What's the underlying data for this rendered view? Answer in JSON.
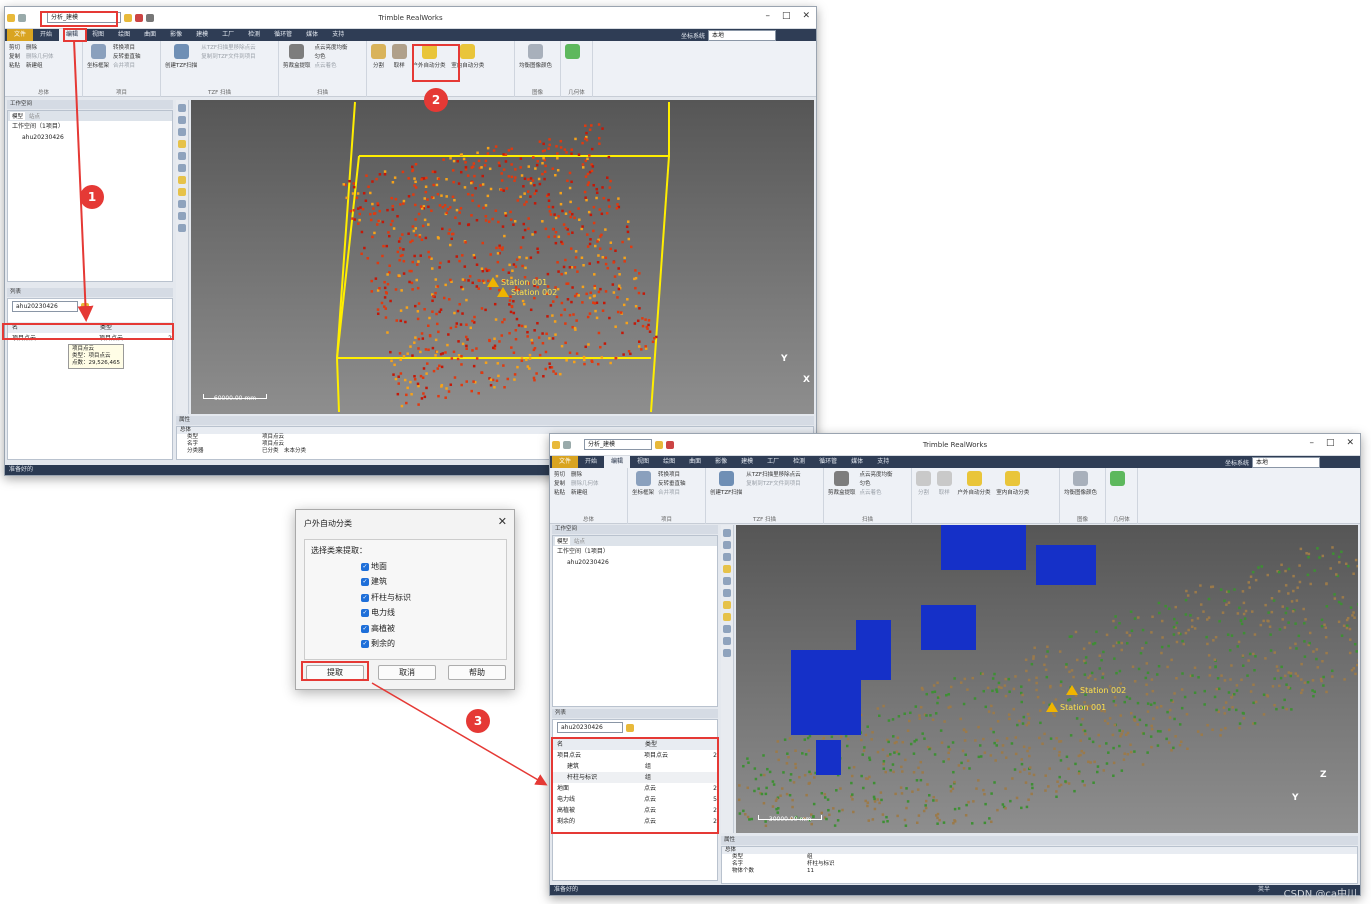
{
  "app_title": "Trimble RealWorks",
  "workflow_combo": "分析_建模",
  "ribbon_tabs": [
    "文件",
    "开始",
    "编辑",
    "视图",
    "绘图",
    "曲面",
    "影像",
    "建模",
    "工厂",
    "检测",
    "循环管",
    "媒体",
    "支持"
  ],
  "coord_system": {
    "label": "坐标系统",
    "value": "本地"
  },
  "ribbon": {
    "group_general": {
      "label": "总体",
      "items": [
        "剪切",
        "删除",
        "复制",
        "删除几何体",
        "粘贴",
        "新建组"
      ]
    },
    "group_project": {
      "label": "项目",
      "big": "坐标框架",
      "items": [
        "转换项目",
        "反转垂直轴",
        "合并项目"
      ]
    },
    "group_tzf": {
      "label": "TZF 扫描",
      "big": "创建TZF扫描",
      "items": [
        "从TZF扫描里移除点云",
        "复制到TZF文件到项目"
      ]
    },
    "group_scan": {
      "label": "扫描",
      "big": "剪裁盒提取",
      "items": [
        "点云亮度均衡",
        "匀色",
        "点云着色"
      ]
    },
    "group_cloud": {
      "label": "点云",
      "items": [
        "分割",
        "取样",
        "户外自动分类",
        "室内自动分类"
      ]
    },
    "group_image": {
      "label": "图像",
      "items": [
        "均衡图像颜色"
      ]
    },
    "group_geom": {
      "label": "几何体"
    }
  },
  "workspace": {
    "header": "工作空间",
    "tab_model": "模型",
    "tab_station": "站点",
    "root": "工作空间（1项目）",
    "project": "ahu20230426"
  },
  "list_panel": {
    "header": "列表",
    "combo": "ahu20230426",
    "col_name": "名",
    "col_type": "类型",
    "col_n": "数"
  },
  "list_before": [
    {
      "name": "项目点云",
      "type": "项目点云",
      "n": "2"
    }
  ],
  "tooltip": [
    "项目点云",
    "类型：项目点云",
    "点数：29,526,465"
  ],
  "list_after": [
    {
      "name": "项目点云",
      "type": "项目点云",
      "n": "2"
    },
    {
      "name": "建筑",
      "type": "组",
      "n": ""
    },
    {
      "name": "杆柱与标识",
      "type": "组",
      "n": ""
    },
    {
      "name": "地面",
      "type": "点云",
      "n": "2"
    },
    {
      "name": "电力线",
      "type": "点云",
      "n": "5"
    },
    {
      "name": "高植被",
      "type": "点云",
      "n": "2"
    },
    {
      "name": "剩余的",
      "type": "点云",
      "n": "2"
    }
  ],
  "viewer1": {
    "stations": [
      "Station 001",
      "Station 002"
    ],
    "scale": "60000.00 mm",
    "axes": [
      "Y",
      "X"
    ]
  },
  "viewer2": {
    "stations": [
      "Station 002",
      "Station 001"
    ],
    "scale": "30000.00 mm",
    "axes": [
      "Z",
      "Y"
    ]
  },
  "props1": {
    "header": "属性",
    "section": "总体",
    "rows": [
      [
        "类型",
        "项目点云"
      ],
      [
        "名字",
        "项目点云"
      ],
      [
        "分类器",
        "已分类　未本分类"
      ]
    ]
  },
  "props2": {
    "header": "属性",
    "section": "总体",
    "rows": [
      [
        "类型",
        "组"
      ],
      [
        "名字",
        "杆柱与标识"
      ],
      [
        "物体个数",
        "11"
      ]
    ]
  },
  "status": "准备好的",
  "dialog": {
    "title": "户外自动分类",
    "fieldset": "选择类来提取：",
    "options": [
      "地面",
      "建筑",
      "杆柱与标识",
      "电力线",
      "高植被",
      "剩余的"
    ],
    "btn_extract": "提取",
    "btn_cancel": "取消",
    "btn_help": "帮助"
  },
  "steps": [
    "1",
    "2",
    "3"
  ],
  "watermark": "CSDN @ca中川",
  "lang_indicator": "英半",
  "colors": {
    "accent": "#e53935",
    "ribbon_tab": "#2f3d55",
    "file_tab": "#d9a421"
  }
}
